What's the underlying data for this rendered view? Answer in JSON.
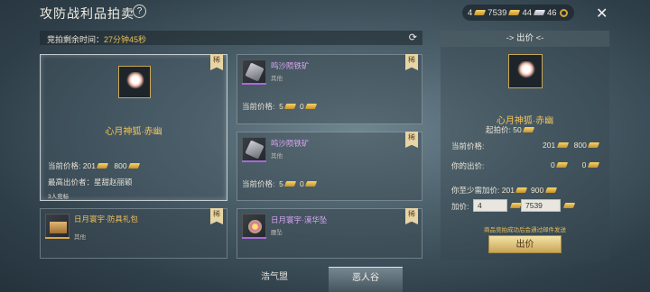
{
  "header": {
    "title": "攻防战利品拍卖",
    "help": "?"
  },
  "currency": {
    "a": "4",
    "b": "7539",
    "c": "44",
    "d": "46"
  },
  "timer": {
    "label": "竞拍剩余时间：",
    "value": "27分钟45秒"
  },
  "badge": "稀",
  "featured": {
    "name": "心月神狐·赤幽",
    "price_label": "当前价格:",
    "price_a": "201",
    "price_b": "800",
    "top_bidder": "最高出价者：星甜赵丽颖",
    "bidders": "3人竞标"
  },
  "items": [
    {
      "name": "鸣沙陨铁矿",
      "cat": "其他",
      "price_label": "当前价格:",
      "price_a": "5",
      "price_b": "0"
    },
    {
      "name": "鸣沙陨铁矿",
      "cat": "其他",
      "price_label": "当前价格:",
      "price_a": "5",
      "price_b": "0"
    },
    {
      "name": "日月寰宇·防具礼包",
      "cat": "其他"
    },
    {
      "name": "日月寰宇·漠华坠",
      "cat": "腰坠"
    }
  ],
  "side": {
    "title": "出价",
    "name": "心月神狐·赤幽",
    "start_label": "起拍价:",
    "start_value": "50",
    "cur_label": "当前价格:",
    "cur_a": "201",
    "cur_b": "800",
    "your_label": "你的出价:",
    "your_a": "0",
    "your_b": "0",
    "min_label": "你至少需加价:",
    "min_a": "201",
    "min_b": "900",
    "add_label": "加价:",
    "add_a": "4",
    "add_b": "7539",
    "note": "商品竞拍成功后会通过邮件发送",
    "button": "出价"
  },
  "tabs": [
    "浩气盟",
    "恶人谷"
  ]
}
